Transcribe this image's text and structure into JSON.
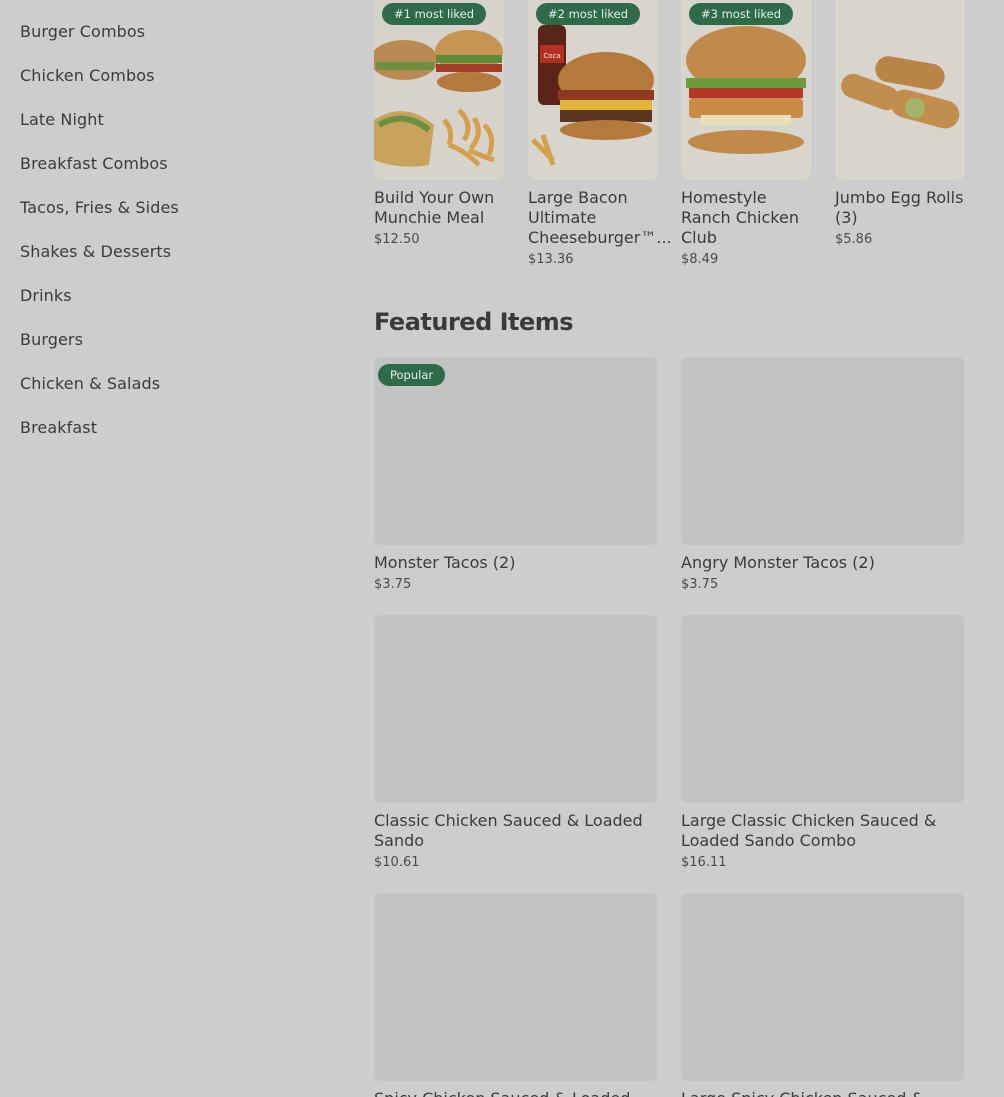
{
  "sidebar": {
    "items": [
      {
        "label": "Burger Combos"
      },
      {
        "label": "Chicken Combos"
      },
      {
        "label": "Late Night"
      },
      {
        "label": "Breakfast Combos"
      },
      {
        "label": "Tacos, Fries & Sides"
      },
      {
        "label": "Shakes & Desserts"
      },
      {
        "label": "Drinks"
      },
      {
        "label": "Burgers"
      },
      {
        "label": "Chicken & Salads"
      },
      {
        "label": "Breakfast"
      }
    ]
  },
  "most_liked": [
    {
      "badge": "#1 most liked",
      "title": "Build Your Own Munchie Meal",
      "price": "$12.50",
      "image_icon": "munchie-meal-image"
    },
    {
      "badge": "#2 most liked",
      "title": "Large Bacon Ultimate Cheeseburger™...",
      "price": "$13.36",
      "image_icon": "bacon-cheeseburger-image"
    },
    {
      "badge": "#3 most liked",
      "title": "Homestyle Ranch Chicken Club",
      "price": "$8.49",
      "image_icon": "ranch-chicken-club-image"
    },
    {
      "badge": "",
      "title": "Jumbo Egg Rolls (3)",
      "price": "$5.86",
      "image_icon": "egg-rolls-image"
    }
  ],
  "featured": {
    "title": "Featured Items",
    "items": [
      {
        "badge": "Popular",
        "title": "Monster Tacos (2)",
        "price": "$3.75"
      },
      {
        "badge": "",
        "title": "Angry Monster Tacos (2)",
        "price": "$3.75"
      },
      {
        "badge": "",
        "title": "Classic Chicken Sauced & Loaded Sando",
        "price": "$10.61"
      },
      {
        "badge": "",
        "title": "Large Classic Chicken Sauced & Loaded Sando Combo",
        "price": "$16.11"
      },
      {
        "badge": "",
        "title": "Spicy Chicken Sauced & Loaded",
        "price": ""
      },
      {
        "badge": "",
        "title": "Large Spicy Chicken Sauced &",
        "price": ""
      }
    ]
  },
  "colors": {
    "overlay_bg": "#cdcdcd",
    "badge_green": "#2f6b48",
    "placeholder": "#c3c3c3"
  }
}
